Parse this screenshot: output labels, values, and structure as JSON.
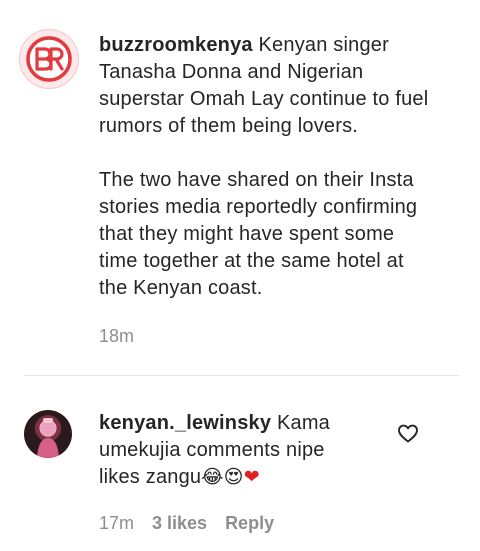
{
  "caption": {
    "username": "buzzroomkenya",
    "text_1": "Kenyan singer Tanasha Donna and Nigerian superstar Omah Lay continue to fuel rumors of them being lovers.",
    "text_2": "The two have shared on their Insta stories media reportedly confirming that they might have spent some time together at the same hotel at the Kenyan coast.",
    "time": "18m"
  },
  "comment": {
    "username": "kenyan._lewinsky",
    "text": "Kama umekujia comments nipe likes zangu",
    "emojis": [
      "😂",
      "😍",
      "❤"
    ],
    "time": "17m",
    "likes": "3 likes",
    "reply_label": "Reply"
  },
  "colors": {
    "text": "#262626",
    "secondary": "#8e8e8e",
    "brand_red": "#e23a3f",
    "heart_red": "#e0201f"
  },
  "icons": {
    "like": "heart-outline-icon",
    "brand_logo": "br-logo-icon"
  }
}
